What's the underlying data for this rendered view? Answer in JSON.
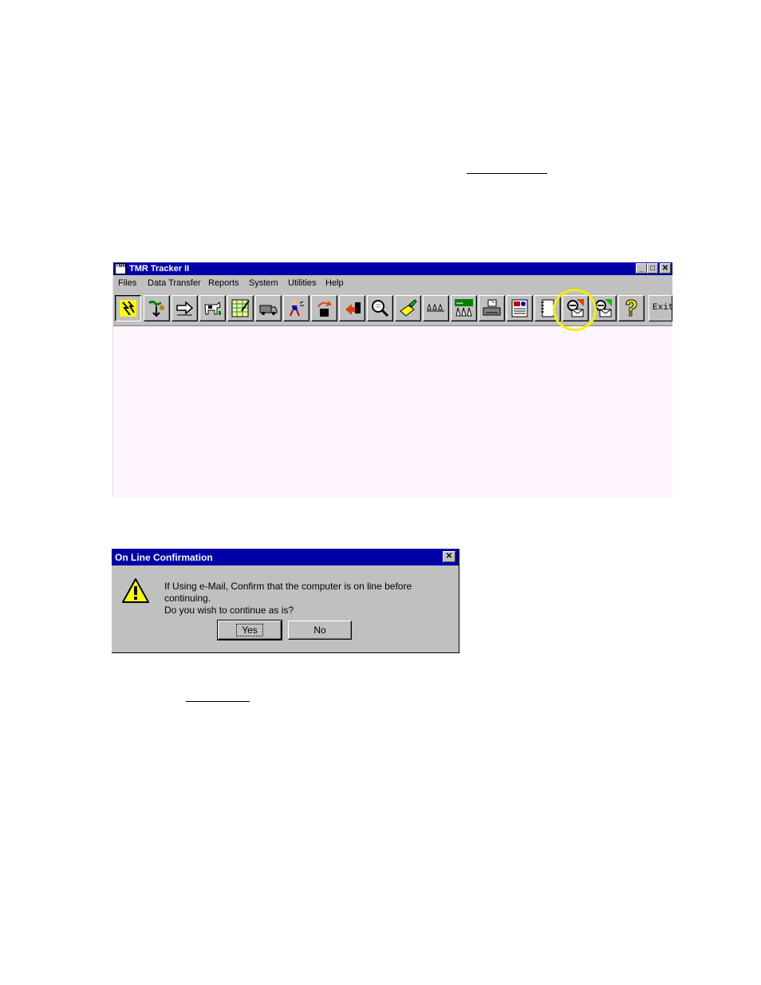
{
  "window": {
    "title": "TMR Tracker II",
    "app_icon_text": "TMR",
    "controls": {
      "minimize": "_",
      "maximize": "□",
      "close": "✕"
    },
    "menu": [
      {
        "label": "Files"
      },
      {
        "label": "Data Transfer"
      },
      {
        "label": "Reports"
      },
      {
        "label": "System"
      },
      {
        "label": "Utilities"
      },
      {
        "label": "Help"
      }
    ],
    "toolbar": {
      "icons": [
        "feed-lightning-icon",
        "feed-load-icon",
        "transfer-arrow-icon",
        "cow-icon",
        "spreadsheet-icon",
        "truck-icon",
        "operator-icon",
        "upload-icon",
        "download-icon",
        "magnifier-icon",
        "eraser-icon",
        "cow-group-icon",
        "pen-group-icon",
        "printer-icon",
        "report-icon",
        "notebook-icon",
        "email-send-icon",
        "email-receive-icon",
        "help-icon"
      ],
      "exit_label": "Exit"
    },
    "highlight_color": "#f4f000"
  },
  "dialog": {
    "title": "On Line Confirmation",
    "close": "✕",
    "message_line1": "If Using e-Mail, Confirm that the computer is on line before continuing.",
    "message_line2": "Do you wish to continue as is?",
    "yes_label": "Yes",
    "no_label": "No"
  },
  "colors": {
    "titlebar": "#0000a8",
    "face": "#c0c0c0",
    "client": "#fdf4fd"
  }
}
